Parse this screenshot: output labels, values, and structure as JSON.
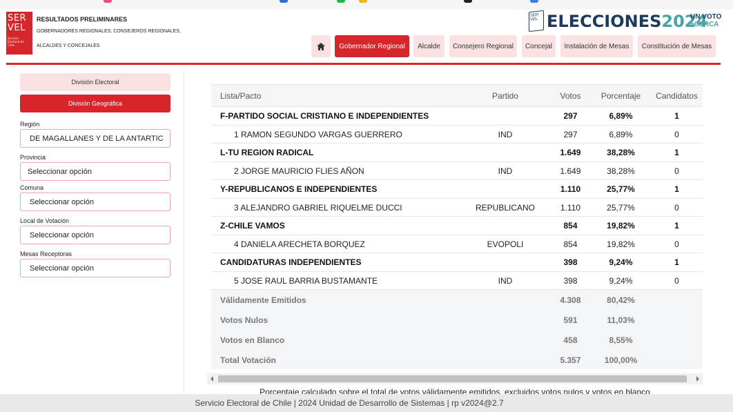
{
  "header": {
    "logo_lines": [
      "SER",
      "VEL"
    ],
    "logo_small": "Servicio Electoral de Chile",
    "title": "RESULTADOS PRELIMINARES",
    "subtitle_line1": "GOBERNADORES REGIONALES, CONSEJEROS REGIONALES,",
    "subtitle_line2": "ALCALDES Y CONCEJALES",
    "brand_word": "ELECCIONES",
    "brand_year": "2024",
    "brand_tag1": "UN VOTO",
    "brand_tag2": "+CERCA",
    "brand_flag": "SER VEL"
  },
  "nav": {
    "home_icon": "home-icon",
    "items": [
      {
        "label": "Gobernador Regional",
        "active": true
      },
      {
        "label": "Alcalde",
        "active": false
      },
      {
        "label": "Consejero Regional",
        "active": false
      },
      {
        "label": "Concejal",
        "active": false
      },
      {
        "label": "Instalación de Mesas",
        "active": false
      },
      {
        "label": "Constitución de Mesas",
        "active": false
      }
    ]
  },
  "sidebar": {
    "electoral_division": "División Electoral",
    "geographic_division": "División Geográfica",
    "filters": [
      {
        "label": "Región",
        "value": "DE MAGALLANES Y DE LA ANTARTIC"
      },
      {
        "label": "Provincia",
        "value": "Seleccionar opción"
      },
      {
        "label": "Comuna",
        "value": "Seleccionar opción"
      },
      {
        "label": "Local de Votación",
        "value": "Seleccionar opción"
      },
      {
        "label": "Mesas Receptoras",
        "value": "Seleccionar opción"
      }
    ]
  },
  "table": {
    "headers": {
      "name": "Lista/Pacto",
      "party": "Partido",
      "votes": "Votos",
      "pct": "Porcentaje",
      "cands": "Candidatos"
    },
    "rows": [
      {
        "kind": "pact",
        "name": "F-PARTIDO SOCIAL CRISTIANO E INDEPENDIENTES",
        "party": "",
        "votes": "297",
        "pct": "6,89%",
        "cands": "1"
      },
      {
        "kind": "cand",
        "name": "1 RAMON SEGUNDO VARGAS GUERRERO",
        "party": "IND",
        "votes": "297",
        "pct": "6,89%",
        "cands": "0"
      },
      {
        "kind": "pact",
        "name": "L-TU REGION RADICAL",
        "party": "",
        "votes": "1.649",
        "pct": "38,28%",
        "cands": "1"
      },
      {
        "kind": "cand",
        "name": "2 JORGE MAURICIO FLIES AÑON",
        "party": "IND",
        "votes": "1.649",
        "pct": "38,28%",
        "cands": "0"
      },
      {
        "kind": "pact",
        "name": "Y-REPUBLICANOS E INDEPENDIENTES",
        "party": "",
        "votes": "1.110",
        "pct": "25,77%",
        "cands": "1"
      },
      {
        "kind": "cand",
        "name": "3 ALEJANDRO GABRIEL RIQUELME DUCCI",
        "party": "REPUBLICANO",
        "votes": "1.110",
        "pct": "25,77%",
        "cands": "0"
      },
      {
        "kind": "pact",
        "name": "Z-CHILE VAMOS",
        "party": "",
        "votes": "854",
        "pct": "19,82%",
        "cands": "1"
      },
      {
        "kind": "cand",
        "name": "4 DANIELA ARECHETA BORQUEZ",
        "party": "EVOPOLI",
        "votes": "854",
        "pct": "19,82%",
        "cands": "0"
      },
      {
        "kind": "pact",
        "name": "CANDIDATURAS INDEPENDIENTES",
        "party": "",
        "votes": "398",
        "pct": "9,24%",
        "cands": "1"
      },
      {
        "kind": "cand",
        "name": "5 JOSE RAUL BARRIA BUSTAMANTE",
        "party": "IND",
        "votes": "398",
        "pct": "9,24%",
        "cands": "0"
      }
    ],
    "summary": [
      {
        "name": "Válidamente Emitidos",
        "votes": "4.308",
        "pct": "80,42%"
      },
      {
        "name": "Votos Nulos",
        "votes": "591",
        "pct": "11,03%"
      },
      {
        "name": "Votos en Blanco",
        "votes": "458",
        "pct": "8,55%"
      },
      {
        "name": "Total Votación",
        "votes": "5.357",
        "pct": "100,00%"
      }
    ]
  },
  "note": "Porcentaje calculado sobre el total de votos válidamente emitidos, excluidos votos nulos y votos en blanco",
  "footer": "Servicio Electoral de Chile | 2024 Unidad de Desarrollo de Sistemas | rp v2024@2.7",
  "colors": {
    "accent": "#d7262b",
    "accent_light": "#fbe1e2",
    "brand_navy": "#1f3a5f",
    "brand_teal": "#4aa3a2"
  }
}
